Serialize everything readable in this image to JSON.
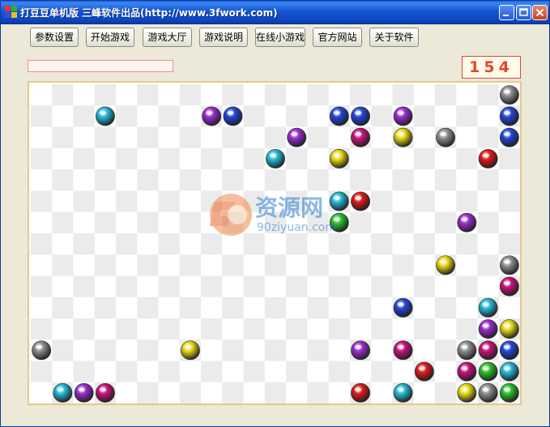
{
  "window": {
    "title": "打豆豆单机版 三峰软件出品(http://www.3fwork.com)"
  },
  "toolbar": {
    "buttons": [
      "参数设置",
      "开始游戏",
      "游戏大厅",
      "游戏说明",
      "在线小游戏",
      "官方网站",
      "关于软件"
    ]
  },
  "progress": {
    "fraction": 0
  },
  "score": {
    "value": "154"
  },
  "watermark": {
    "text_cn": "资源网",
    "text_en": "90ziyuan.com"
  },
  "board": {
    "cols": 23,
    "rows": 15,
    "checker_light": "#ffffff",
    "checker_dark": "#ebebeb",
    "colors": {
      "blue": "#2244dd",
      "cyan": "#22b8d8",
      "purple": "#9a2ad0",
      "magenta": "#c8107a",
      "yellow": "#e8d810",
      "gray": "#8c8c8c",
      "red": "#e01818",
      "green": "#28c028"
    },
    "balls": [
      {
        "c": 22,
        "r": 0,
        "color": "gray"
      },
      {
        "c": 3,
        "r": 1,
        "color": "cyan"
      },
      {
        "c": 8,
        "r": 1,
        "color": "purple"
      },
      {
        "c": 9,
        "r": 1,
        "color": "blue"
      },
      {
        "c": 14,
        "r": 1,
        "color": "blue"
      },
      {
        "c": 15,
        "r": 1,
        "color": "blue"
      },
      {
        "c": 17,
        "r": 1,
        "color": "purple"
      },
      {
        "c": 22,
        "r": 1,
        "color": "blue"
      },
      {
        "c": 12,
        "r": 2,
        "color": "purple"
      },
      {
        "c": 15,
        "r": 2,
        "color": "magenta"
      },
      {
        "c": 17,
        "r": 2,
        "color": "yellow"
      },
      {
        "c": 19,
        "r": 2,
        "color": "gray"
      },
      {
        "c": 22,
        "r": 2,
        "color": "blue"
      },
      {
        "c": 11,
        "r": 3,
        "color": "cyan"
      },
      {
        "c": 14,
        "r": 3,
        "color": "yellow"
      },
      {
        "c": 21,
        "r": 3,
        "color": "red"
      },
      {
        "c": 14,
        "r": 5,
        "color": "cyan"
      },
      {
        "c": 15,
        "r": 5,
        "color": "red"
      },
      {
        "c": 14,
        "r": 6,
        "color": "green"
      },
      {
        "c": 20,
        "r": 6,
        "color": "purple"
      },
      {
        "c": 19,
        "r": 8,
        "color": "yellow"
      },
      {
        "c": 22,
        "r": 8,
        "color": "gray"
      },
      {
        "c": 22,
        "r": 9,
        "color": "magenta"
      },
      {
        "c": 17,
        "r": 10,
        "color": "blue"
      },
      {
        "c": 21,
        "r": 10,
        "color": "cyan"
      },
      {
        "c": 21,
        "r": 11,
        "color": "purple"
      },
      {
        "c": 22,
        "r": 11,
        "color": "yellow"
      },
      {
        "c": 0,
        "r": 12,
        "color": "gray"
      },
      {
        "c": 7,
        "r": 12,
        "color": "yellow"
      },
      {
        "c": 15,
        "r": 12,
        "color": "purple"
      },
      {
        "c": 17,
        "r": 12,
        "color": "magenta"
      },
      {
        "c": 20,
        "r": 12,
        "color": "gray"
      },
      {
        "c": 21,
        "r": 12,
        "color": "magenta"
      },
      {
        "c": 22,
        "r": 12,
        "color": "blue"
      },
      {
        "c": 18,
        "r": 13,
        "color": "red"
      },
      {
        "c": 20,
        "r": 13,
        "color": "magenta"
      },
      {
        "c": 21,
        "r": 13,
        "color": "green"
      },
      {
        "c": 22,
        "r": 13,
        "color": "cyan"
      },
      {
        "c": 1,
        "r": 14,
        "color": "cyan"
      },
      {
        "c": 2,
        "r": 14,
        "color": "purple"
      },
      {
        "c": 3,
        "r": 14,
        "color": "magenta"
      },
      {
        "c": 15,
        "r": 14,
        "color": "red"
      },
      {
        "c": 17,
        "r": 14,
        "color": "cyan"
      },
      {
        "c": 20,
        "r": 14,
        "color": "yellow"
      },
      {
        "c": 21,
        "r": 14,
        "color": "gray"
      },
      {
        "c": 22,
        "r": 14,
        "color": "green"
      }
    ]
  }
}
